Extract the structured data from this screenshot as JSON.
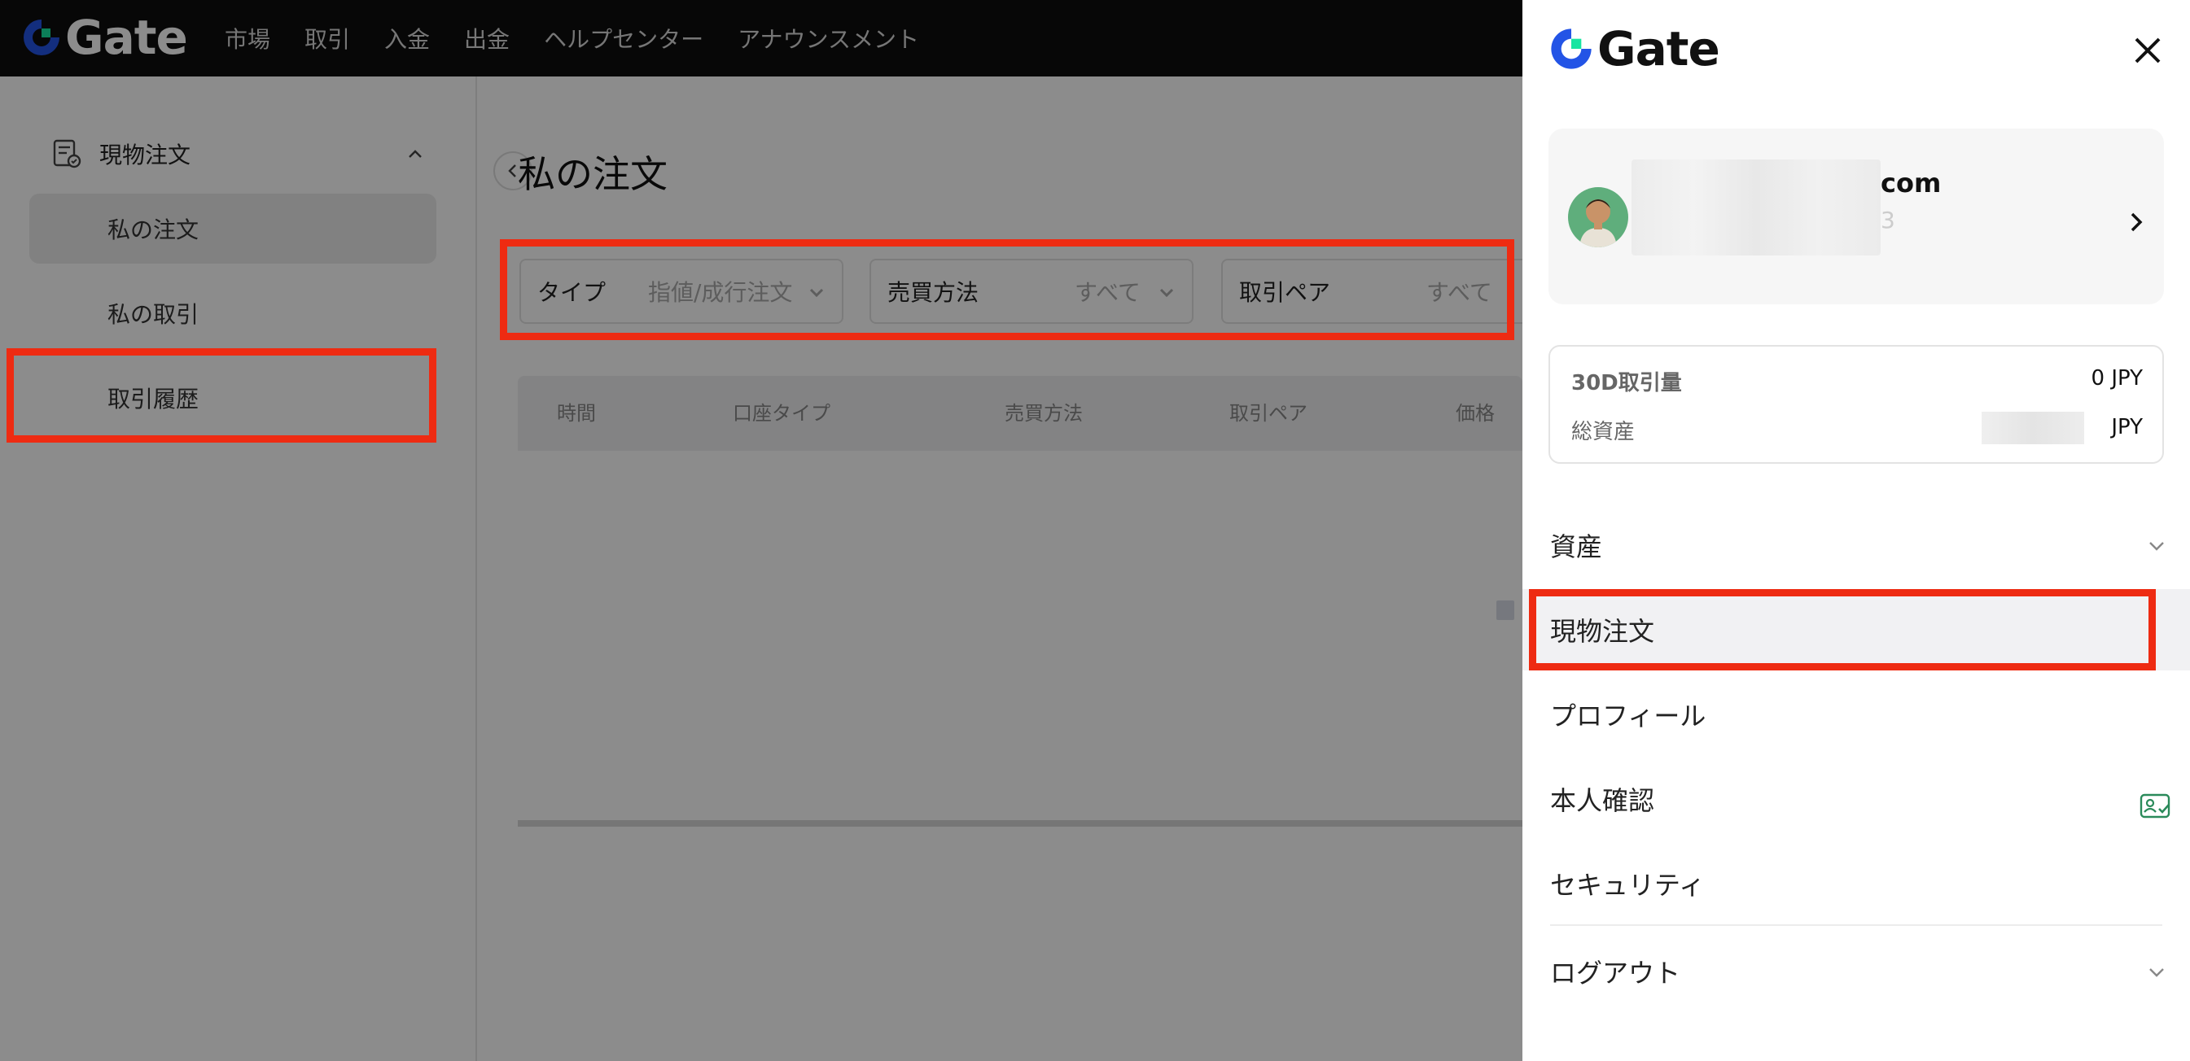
{
  "brand": {
    "name": "Gate"
  },
  "top_nav": {
    "items": [
      "市場",
      "取引",
      "入金",
      "出金",
      "ヘルプセンター",
      "アナウンスメント"
    ]
  },
  "sidebar": {
    "group_label": "現物注文",
    "items": [
      {
        "label": "私の注文",
        "active": true
      },
      {
        "label": "私の取引",
        "active": false
      },
      {
        "label": "取引履歴",
        "active": false
      }
    ]
  },
  "main": {
    "title": "私の注文",
    "filters": [
      {
        "label": "タイプ",
        "value": "指値/成行注文"
      },
      {
        "label": "売買方法",
        "value": "すべて"
      },
      {
        "label": "取引ペア",
        "value": "すべて"
      }
    ],
    "table_headers": [
      "時間",
      "口座タイプ",
      "売買方法",
      "取引ペア",
      "価格"
    ]
  },
  "panel": {
    "user": {
      "email_suffix": "com",
      "uid_tail": "3"
    },
    "stats": [
      {
        "label": "30D取引量",
        "value": "0 JPY"
      },
      {
        "label": "総資産",
        "value": "JPY"
      }
    ],
    "menu": [
      {
        "label": "資産",
        "has_chevron": true,
        "active": false
      },
      {
        "label": "現物注文",
        "has_chevron": false,
        "active": true
      },
      {
        "label": "プロフィール",
        "has_chevron": false,
        "active": false
      },
      {
        "label": "本人確認",
        "has_chevron": false,
        "active": false,
        "icon": "id-verified-icon"
      },
      {
        "label": "セキュリティ",
        "has_chevron": false,
        "active": false
      },
      {
        "label": "ログアウト",
        "has_chevron": true,
        "active": false
      }
    ]
  },
  "colors": {
    "highlight": "#ee2b12",
    "brand_blue": "#2354e6",
    "brand_green": "#17e5a1",
    "verify_green": "#2a8a5a"
  }
}
